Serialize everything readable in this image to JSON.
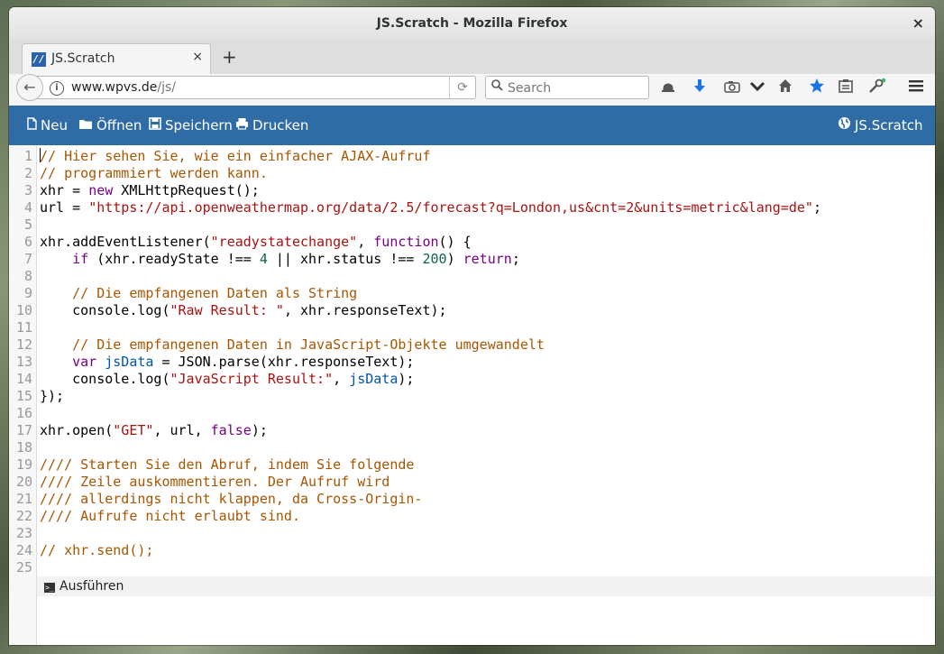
{
  "window": {
    "title": "JS.Scratch - Mozilla Firefox",
    "close_glyph": "×"
  },
  "tab": {
    "favicon_text": "//",
    "title": "JS.Scratch",
    "close_glyph": "×"
  },
  "newtab_glyph": "+",
  "navbar": {
    "back_glyph": "←",
    "info_glyph": "i",
    "url_host": "www.wpvs.de",
    "url_path": "/js/",
    "reload_glyph": "⟳",
    "search_placeholder": "Search",
    "icons": [
      "screenshot-icon",
      "download-icon",
      "camera-icon",
      "pocket-icon",
      "home-icon",
      "bookmark-star-icon",
      "reading-list-icon",
      "developer-tools-icon",
      "hamburger-menu-icon"
    ]
  },
  "app_toolbar": {
    "new_label": "Neu",
    "open_label": "Öffnen",
    "save_label": "Speichern",
    "print_label": "Drucken",
    "brand_label": "JS.Scratch"
  },
  "editor": {
    "line_numbers": [
      "1",
      "2",
      "3",
      "4",
      "5",
      "6",
      "7",
      "8",
      "9",
      "10",
      "11",
      "12",
      "13",
      "14",
      "15",
      "16",
      "17",
      "18",
      "19",
      "20",
      "21",
      "22",
      "23",
      "24",
      "25"
    ],
    "lines": [
      "// Hier sehen Sie, wie ein einfacher AJAX-Aufruf",
      "// programmiert werden kann.",
      "xhr = new XMLHttpRequest();",
      "url = \"https://api.openweathermap.org/data/2.5/forecast?q=London,us&cnt=2&units=metric&lang=de\";",
      "",
      "xhr.addEventListener(\"readystatechange\", function() {",
      "    if (xhr.readyState !== 4 || xhr.status !== 200) return;",
      "",
      "    // Die empfangenen Daten als String",
      "    console.log(\"Raw Result: \", xhr.responseText);",
      "",
      "    // Die empfangenen Daten in JavaScript-Objekte umgewandelt",
      "    var jsData = JSON.parse(xhr.responseText);",
      "    console.log(\"JavaScript Result:\", jsData);",
      "});",
      "",
      "xhr.open(\"GET\", url, false);",
      "",
      "//// Starten Sie den Abruf, indem Sie folgende",
      "//// Zeile auskommentieren. Der Aufruf wird",
      "//// allerdings nicht klappen, da Cross-Origin-",
      "//// Aufrufe nicht erlaubt sind.",
      "",
      "// xhr.send();",
      ""
    ]
  },
  "run_bar": {
    "run_label": "Ausführen"
  },
  "colors": {
    "toolbar_blue": "#2f6ba5",
    "comment": "#a85500",
    "keyword": "#770088",
    "string": "#aa1111",
    "number": "#116644",
    "variable_def": "#0055aa"
  }
}
